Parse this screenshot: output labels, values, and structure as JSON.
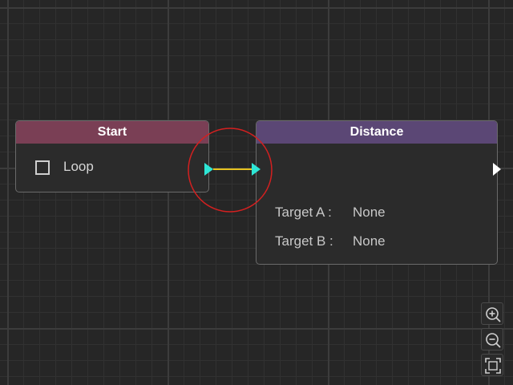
{
  "start_node": {
    "title": "Start",
    "loop_label": "Loop",
    "loop_checked": false
  },
  "distance_node": {
    "title": "Distance",
    "fields": [
      {
        "label": "Target A :",
        "value": "None"
      },
      {
        "label": "Target B :",
        "value": "None"
      }
    ]
  },
  "colors": {
    "canvas_background": "#262626",
    "start_header": "#7a3f55",
    "distance_header": "#5b4775",
    "port_color": "#2ee6d6",
    "connection_color": "#e6c21f",
    "highlight_circle": "#d42020"
  },
  "zoom_controls": {
    "zoom_in_icon": "zoom-in-icon",
    "zoom_out_icon": "zoom-out-icon",
    "fit_view_icon": "fit-view-icon"
  }
}
